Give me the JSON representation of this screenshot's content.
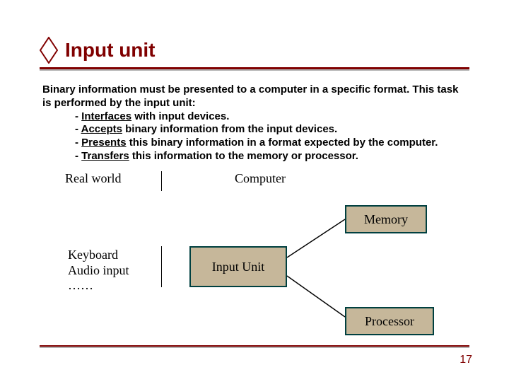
{
  "title": "Input unit",
  "intro": "Binary information must be presented to a computer in a specific format. This task is performed by the input unit:",
  "bullets": [
    {
      "kw": "Interfaces",
      "rest": " with input devices."
    },
    {
      "kw": "Accepts",
      "rest": " binary information from the input devices."
    },
    {
      "kw": "Presents",
      "rest": " this binary information in a format expected by the computer."
    },
    {
      "kw": "Transfers",
      "rest": " this information to the memory or processor."
    }
  ],
  "diagram": {
    "labels": {
      "realworld": "Real world",
      "computer": "Computer"
    },
    "keyboard_lines": [
      "Keyboard",
      "Audio input",
      "……"
    ],
    "boxes": {
      "input_unit": "Input Unit",
      "memory": "Memory",
      "processor": "Processor"
    }
  },
  "page": "17"
}
